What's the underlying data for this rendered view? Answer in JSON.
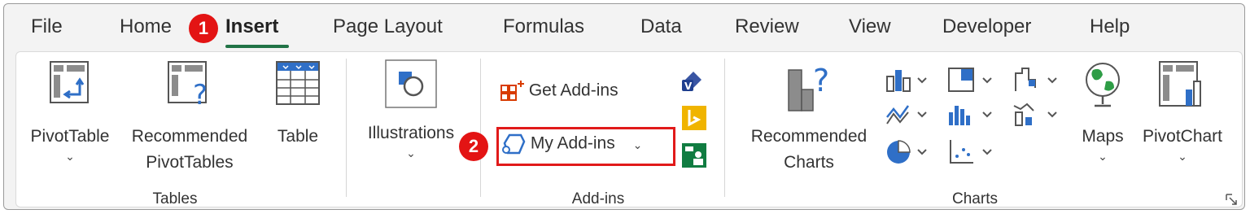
{
  "tabs": [
    "File",
    "Home",
    "Insert",
    "Page Layout",
    "Formulas",
    "Data",
    "Review",
    "View",
    "Developer",
    "Help"
  ],
  "active_tab": "Insert",
  "annotations": [
    "1",
    "2"
  ],
  "groups": {
    "tables": {
      "label": "Tables",
      "pivot_table": [
        "PivotTable",
        "⌄"
      ],
      "recommended": [
        "Recommended",
        "PivotTables"
      ],
      "table": "Table"
    },
    "illustrations": {
      "label": "Illustrations",
      "chevron": "⌄"
    },
    "addins": {
      "label": "Add-ins",
      "get_addins": "Get Add-ins",
      "my_addins": "My Add-ins",
      "my_addins_chevron": "⌄"
    },
    "charts": {
      "label": "Charts",
      "recommended": [
        "Recommended",
        "Charts"
      ],
      "maps": [
        "Maps",
        "⌄"
      ],
      "pivot_chart": [
        "PivotChart",
        "⌄"
      ]
    }
  },
  "colors": {
    "accent_green": "#217346",
    "highlight_red": "#e11a1a",
    "icon_blue": "#2f6fc7"
  }
}
